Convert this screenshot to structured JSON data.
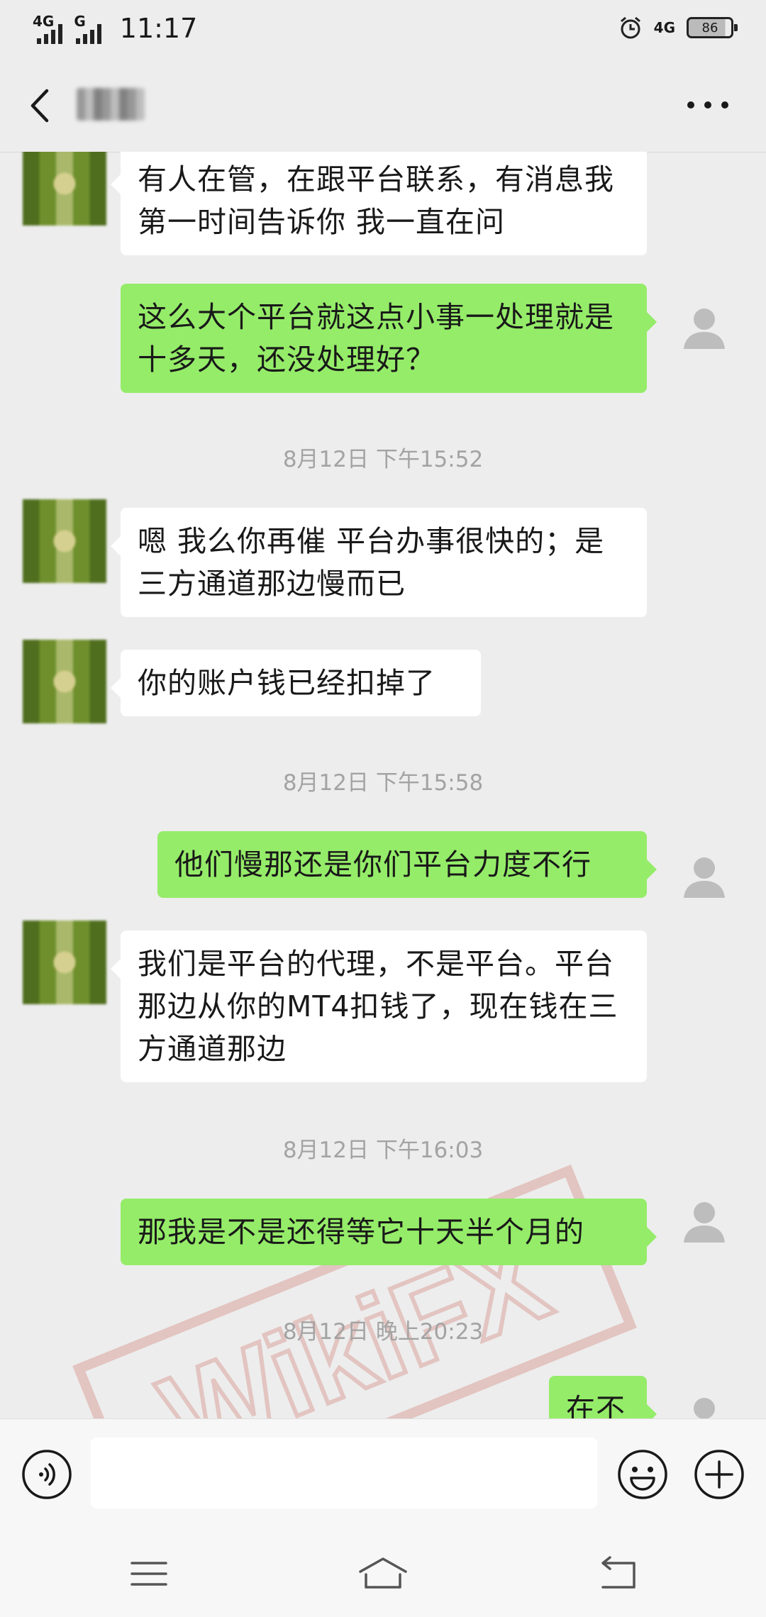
{
  "status_bar": {
    "network_1": "4G",
    "network_2": "G",
    "time": "11:17",
    "network_right": "4G",
    "battery": "86"
  },
  "header": {
    "contact_name_blurred": true
  },
  "messages": [
    {
      "side": "left",
      "text": "有人在管，在跟平台联系，有消息我第一时间告诉你 我一直在问"
    },
    {
      "side": "right",
      "text": "这么大个平台就这点小事一处理就是十多天，还没处理好？"
    },
    {
      "type": "timestamp",
      "text": "8月12日 下午15:52"
    },
    {
      "side": "left",
      "text": "嗯 我么你再催 平台办事很快的；是三方通道那边慢而已"
    },
    {
      "side": "left",
      "text": "你的账户钱已经扣掉了"
    },
    {
      "type": "timestamp",
      "text": "8月12日 下午15:58"
    },
    {
      "side": "right",
      "text": "他们慢那还是你们平台力度不行"
    },
    {
      "side": "left",
      "text": "我们是平台的代理，不是平台。平台那边从你的MT4扣钱了，现在钱在三方通道那边"
    },
    {
      "type": "timestamp",
      "text": "8月12日 下午16:03"
    },
    {
      "side": "right",
      "text": "那我是不是还得等它十天半个月的"
    },
    {
      "type": "timestamp",
      "text": "8月12日 晚上20:23"
    },
    {
      "side": "right",
      "text": "在不"
    }
  ],
  "watermark": {
    "text": "WikiFX",
    "color": "#c0392b"
  },
  "input_bar": {
    "voice_icon": "voice-icon",
    "emoji_icon": "emoji-icon",
    "plus_icon": "plus-icon",
    "text_value": ""
  },
  "nav_bar": {
    "menu_icon": "menu-icon",
    "home_icon": "home-icon",
    "back_icon": "back-icon"
  },
  "colors": {
    "background": "#ededed",
    "bubble_self": "#95ec69",
    "bubble_other": "#ffffff",
    "timestamp": "#a3a3a3"
  }
}
